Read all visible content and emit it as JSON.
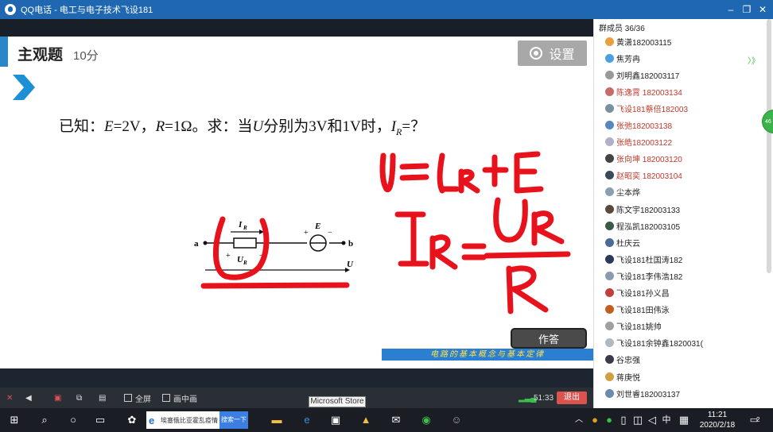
{
  "window": {
    "title": "QQ电话 - 电工与电子技术飞设181",
    "minimize": "–",
    "restore": "❐",
    "close": "✕"
  },
  "slide": {
    "heading": "主观题",
    "points": "10分",
    "settings_label": "设置",
    "question_parts": [
      "已知：",
      "E",
      "=2V，",
      "R",
      "=1Ω。求：当",
      "U",
      "分别为3V和1V时，",
      "I",
      "R",
      "=？"
    ],
    "circuit": {
      "node_a": "a",
      "node_b": "b",
      "current_label": "I",
      "current_sub": "R",
      "voltage_label": "U",
      "voltage_sub": "R",
      "source_label": "E",
      "total_voltage": "U",
      "plus": "+",
      "minus": "−"
    },
    "answer_button": "作答",
    "banner": "电路的基本概念与基本定律"
  },
  "controls": {
    "fullscreen": "全屏",
    "pip": "画中画",
    "timer": "51:33",
    "exit": "退出",
    "tooltip": "Microsoft Store"
  },
  "members": {
    "header": "群成员 36/36",
    "list": [
      {
        "name": "黄潇182003115",
        "color": "#222222",
        "avatar": "#e8a040"
      },
      {
        "name": "焦芳冉",
        "color": "#222222",
        "avatar": "#4aa0e0"
      },
      {
        "name": "刘明鑫182003117",
        "color": "#222222",
        "avatar": "#999999"
      },
      {
        "name": "陈逸霄 182003134",
        "color": "#c0392b",
        "avatar": "#c96a6a"
      },
      {
        "name": "飞设181蔡倍182003",
        "color": "#c0392b",
        "avatar": "#7a8fa0"
      },
      {
        "name": "张弛182003138",
        "color": "#c0392b",
        "avatar": "#5a86c0"
      },
      {
        "name": "张皓182003122",
        "color": "#c0392b",
        "avatar": "#b0b0c8"
      },
      {
        "name": "张向坤 182003120",
        "color": "#c0392b",
        "avatar": "#444444"
      },
      {
        "name": "赵昭奕 182003104",
        "color": "#c0392b",
        "avatar": "#3a4a5a"
      },
      {
        "name": "尘本烨",
        "color": "#222222",
        "avatar": "#8aa0b0"
      },
      {
        "name": "陈文宇182003133",
        "color": "#222222",
        "avatar": "#5a4a3a"
      },
      {
        "name": "程泓凯182003105",
        "color": "#222222",
        "avatar": "#3a5a4a"
      },
      {
        "name": "杜庆云",
        "color": "#222222",
        "avatar": "#4a6a9a"
      },
      {
        "name": "飞设181杜国涛182",
        "color": "#222222",
        "avatar": "#2a3a5a"
      },
      {
        "name": "飞设181李伟浩182",
        "color": "#222222",
        "avatar": "#8a9ab0"
      },
      {
        "name": "飞设181孙义昌",
        "color": "#222222",
        "avatar": "#c04040"
      },
      {
        "name": "飞设181田伟泳",
        "color": "#222222",
        "avatar": "#c06020"
      },
      {
        "name": "飞设181姚帅",
        "color": "#222222",
        "avatar": "#a0a0a0"
      },
      {
        "name": "飞设181余钟鑫1820031(",
        "color": "#222222",
        "avatar": "#b0b8c0"
      },
      {
        "name": "谷忠强",
        "color": "#222222",
        "avatar": "#3a3a4a"
      },
      {
        "name": "蒋庚悦",
        "color": "#222222",
        "avatar": "#d0a040"
      },
      {
        "name": "刘世睿182003137",
        "color": "#222222",
        "avatar": "#6a8ab0"
      }
    ],
    "badge": "46"
  },
  "taskbar": {
    "search_text": "埃塞俄比亚霍乱疫情",
    "search_button": "搜索一下",
    "ime": "中",
    "time": "11:21",
    "date": "2020/2/18",
    "notifications": "2"
  },
  "colors": {
    "titlebar": "#1f67b0",
    "accent": "#2a86c9",
    "ink": "#e8121c",
    "exit": "#d9534f"
  }
}
